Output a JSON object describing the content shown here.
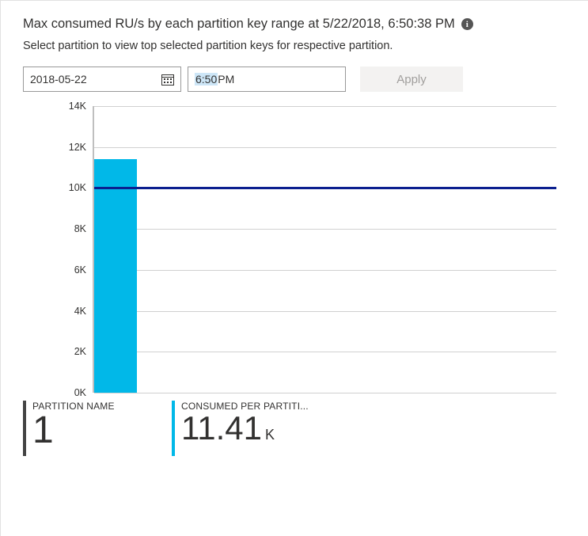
{
  "title": "Max consumed RU/s by each partition key range at 5/22/2018, 6:50:38 PM",
  "subtitle": "Select partition to view top selected partition keys for respective partition.",
  "controls": {
    "date_value": "2018-05-22",
    "time_hour_min": "6:50",
    "time_ampm": " PM",
    "apply_label": "Apply"
  },
  "chart_data": {
    "type": "bar",
    "categories": [
      "1"
    ],
    "values": [
      11410
    ],
    "threshold": 10000,
    "ylim": [
      0,
      14000
    ],
    "yticks": [
      0,
      2000,
      4000,
      6000,
      8000,
      10000,
      12000,
      14000
    ],
    "ytick_labels": [
      "0K",
      "2K",
      "4K",
      "6K",
      "8K",
      "10K",
      "12K",
      "14K"
    ],
    "title": "Max consumed RU/s by each partition key range",
    "xlabel": "PARTITION NAME",
    "ylabel": "CONSUMED PER PARTITION",
    "bar_color": "#01b8e8",
    "threshold_color": "#0b1f8f"
  },
  "summary": {
    "partition_label": "PARTITION NAME",
    "partition_value": "1",
    "consumed_label": "CONSUMED PER PARTITI...",
    "consumed_value": "11.41",
    "consumed_unit": "K"
  }
}
